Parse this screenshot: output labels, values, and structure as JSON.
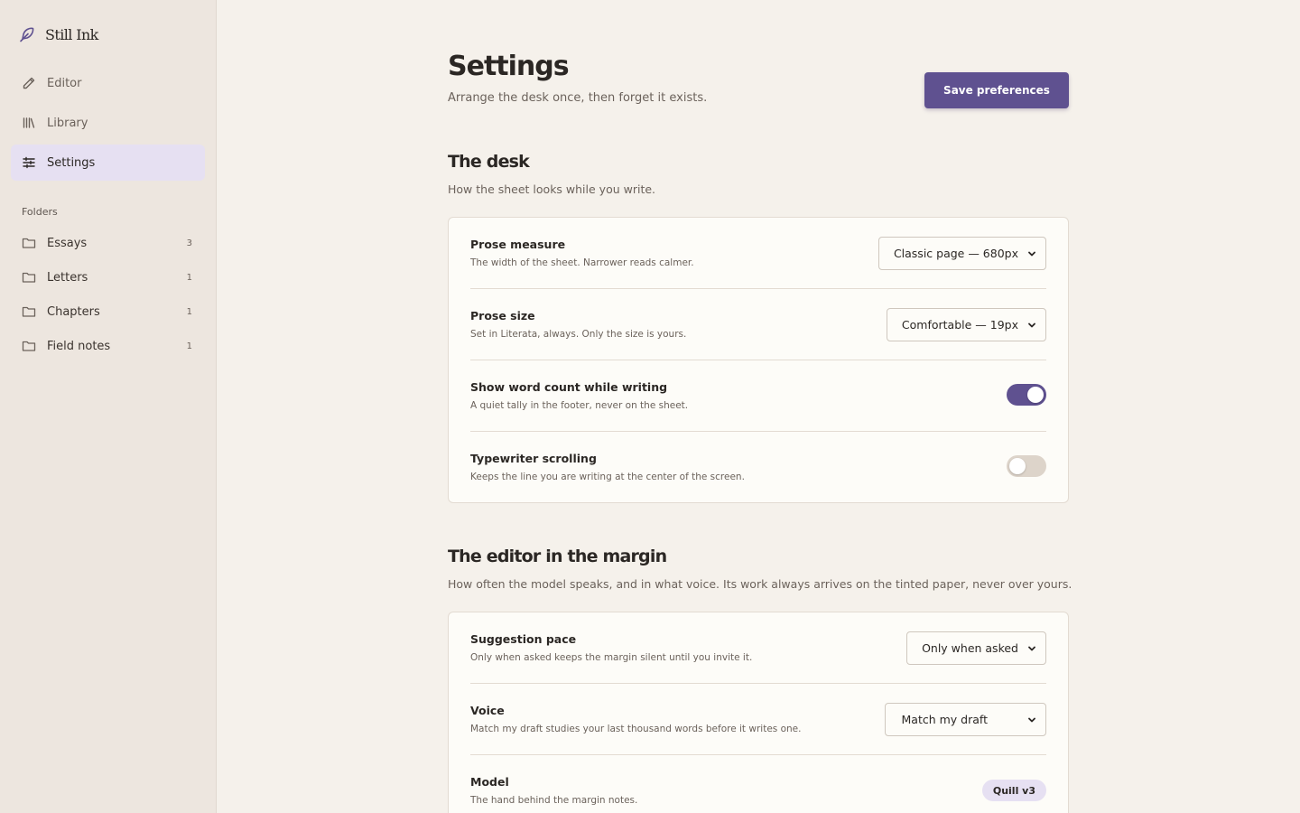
{
  "app": {
    "name": "Still Ink",
    "icon": "feather-icon"
  },
  "nav": [
    {
      "label": "Editor",
      "icon": "pencil-icon",
      "active": false
    },
    {
      "label": "Library",
      "icon": "books-icon",
      "active": false
    },
    {
      "label": "Settings",
      "icon": "sliders-icon",
      "active": true
    }
  ],
  "folders": {
    "label": "Folders",
    "items": [
      {
        "name": "Essays",
        "count": "3"
      },
      {
        "name": "Letters",
        "count": "1"
      },
      {
        "name": "Chapters",
        "count": "1"
      },
      {
        "name": "Field notes",
        "count": "1"
      }
    ]
  },
  "header": {
    "title": "Settings",
    "subtitle": "Arrange the desk once, then forget it exists.",
    "save_label": "Save preferences"
  },
  "desk": {
    "title": "The desk",
    "subtitle": "How the sheet looks while you write.",
    "prose_measure": {
      "label": "Prose measure",
      "desc": "The width of the sheet. Narrower reads calmer.",
      "value": "Classic page — 680px"
    },
    "prose_size": {
      "label": "Prose size",
      "desc": "Set in Literata, always. Only the size is yours.",
      "value": "Comfortable — 19px"
    },
    "word_count": {
      "label": "Show word count while writing",
      "desc": "A quiet tally in the footer, never on the sheet.",
      "on": true
    },
    "typewriter": {
      "label": "Typewriter scrolling",
      "desc": "Keeps the line you are writing at the center of the screen.",
      "on": false
    }
  },
  "margin": {
    "title": "The editor in the margin",
    "subtitle": "How often the model speaks, and in what voice. Its work always arrives on the tinted paper, never over yours.",
    "pace": {
      "label": "Suggestion pace",
      "desc": "Only when asked keeps the margin silent until you invite it.",
      "value": "Only when asked"
    },
    "voice": {
      "label": "Voice",
      "desc": "Match my draft studies your last thousand words before it writes one.",
      "value": "Match my draft"
    },
    "model": {
      "label": "Model",
      "desc": "The hand behind the margin notes.",
      "value": "Quill v3"
    }
  },
  "colors": {
    "accent": "#5f5190",
    "accent_soft": "#e6e0f2",
    "sidebar_bg": "#ede6df",
    "page_bg": "#f5f1eb"
  }
}
